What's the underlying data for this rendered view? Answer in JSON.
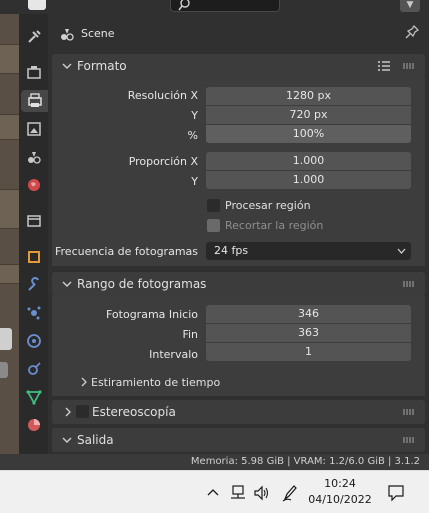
{
  "header": {
    "title": "Scene"
  },
  "panels": {
    "formato": {
      "title": "Formato",
      "res_x_label": "Resolución X",
      "res_x_value": "1280 px",
      "res_y_label": "Y",
      "res_y_value": "720 px",
      "pct_label": "%",
      "pct_value": "100%",
      "aspect_x_label": "Proporción X",
      "aspect_x_value": "1.000",
      "aspect_y_label": "Y",
      "aspect_y_value": "1.000",
      "render_region_label": "Procesar región",
      "crop_region_label": "Recortar la región",
      "fps_label": "Frecuencia de fotogramas",
      "fps_value": "24 fps"
    },
    "frame_range": {
      "title": "Rango de fotogramas",
      "start_label": "Fotograma  Inicio",
      "start_value": "346",
      "end_label": "Fin",
      "end_value": "363",
      "step_label": "Intervalo",
      "step_value": "1",
      "time_stretch_label": "Estiramiento de tiempo"
    },
    "stereoscopy": {
      "title": "Estereoscopía"
    },
    "output": {
      "title": "Salida"
    }
  },
  "status_bar": {
    "text": "Memoria: 5.98 GiB | VRAM: 1.2/6.0 GiB | 3.1.2"
  },
  "taskbar": {
    "time": "10:24",
    "date": "04/10/2022"
  },
  "colors": {
    "accent": "#4772b3",
    "panel_bg": "#3d3d3d",
    "field_bg": "#545454",
    "editor_bg": "#303030"
  }
}
